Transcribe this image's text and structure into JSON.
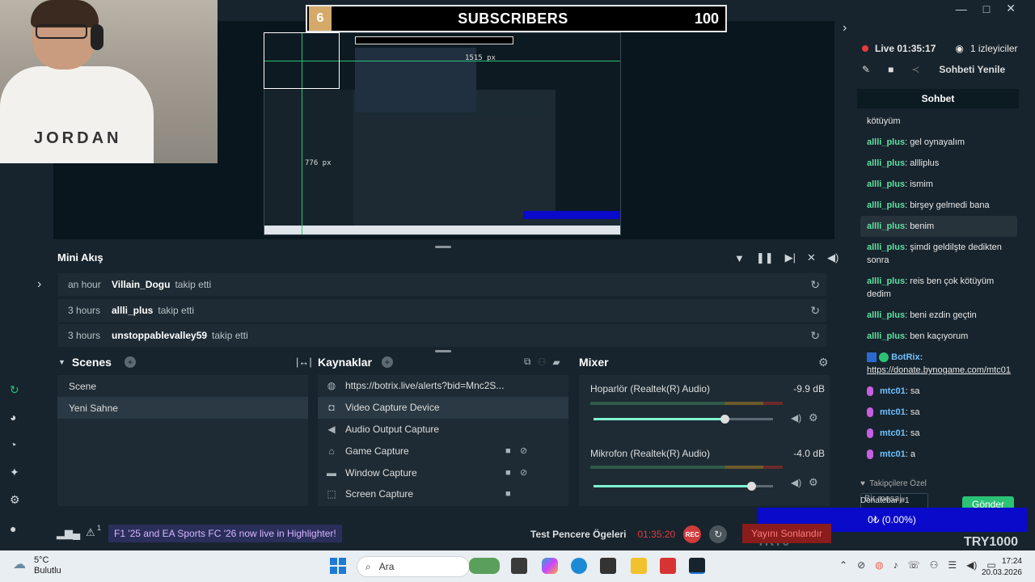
{
  "window": {
    "controls": [
      "—",
      "□",
      "✕"
    ]
  },
  "overlay": {
    "sub_count": "6",
    "sub_title": "SUBSCRIBERS",
    "sub_goal": "100",
    "webcam_text": "JORDAN"
  },
  "canvas_preview": {
    "guide_h": "1515 px",
    "guide_v": "776 px"
  },
  "stream": {
    "live_label": "Live 01:35:17",
    "viewers": "1 izleyiciler",
    "refresh_chat": "Sohbeti Yenile"
  },
  "chat": {
    "title": "Sohbet",
    "messages": [
      {
        "user": "",
        "text": "kötüyüm"
      },
      {
        "user": "allli_plus",
        "text": ": gel oynayalım"
      },
      {
        "user": "allli_plus",
        "text": ": allliplus"
      },
      {
        "user": "allli_plus",
        "text": ": ismim"
      },
      {
        "user": "allli_plus",
        "text": ": birşey gelmedi bana"
      },
      {
        "user": "allli_plus",
        "text": ": benim"
      },
      {
        "user": "allli_plus",
        "text": ": şimdi geldilşte dedikten sonra"
      },
      {
        "user": "allli_plus",
        "text": ": reis ben çok kötüyüm dedim"
      },
      {
        "user": "allli_plus",
        "text": ": beni ezdin geçtin"
      },
      {
        "user": "allli_plus",
        "text": ": ben kaçıyorum"
      }
    ],
    "bot": {
      "name": "BotRix:",
      "link": "https://donate.bynogame.com/mtc01"
    },
    "mic_messages": [
      {
        "user": "mtc01",
        "text": ": sa"
      },
      {
        "user": "mtc01",
        "text": ": sa"
      },
      {
        "user": "mtc01",
        "text": ": sa"
      },
      {
        "user": "mtc01",
        "text": ": a"
      }
    ],
    "followers_only": "Takipçilere Özel",
    "input_placeholder": "Bir mesaj",
    "send_label": "Gönder"
  },
  "donate": {
    "label": "Donatebar #1",
    "progress_text": "0₺ (0.00%)",
    "progress": 0,
    "brand": "TRY1000",
    "brand2": "TRY0"
  },
  "mini_feed": {
    "title": "Mini Akış",
    "rows": [
      {
        "time": "an hour",
        "name": "Villain_Dogu",
        "action": "takip etti"
      },
      {
        "time": "3 hours",
        "name": "allli_plus",
        "action": "takip etti"
      },
      {
        "time": "3 hours",
        "name": "unstoppablevalley59",
        "action": "takip etti"
      }
    ]
  },
  "scenes": {
    "title": "Scenes",
    "items": [
      "Scene",
      "Yeni Sahne"
    ],
    "selected": 1
  },
  "sources": {
    "title": "Kaynaklar",
    "items": [
      {
        "label": "https://botrix.live/alerts?bid=Mnc2S...",
        "icon": "globe-icon",
        "glyph": "◍",
        "lock": false,
        "eye": false
      },
      {
        "label": "Video Capture Device",
        "icon": "camera-icon",
        "glyph": "◘",
        "lock": false,
        "eye": false
      },
      {
        "label": "Audio Output Capture",
        "icon": "speaker-icon",
        "glyph": "◀",
        "lock": false,
        "eye": false
      },
      {
        "label": "Game Capture",
        "icon": "gamepad-icon",
        "glyph": "⌂",
        "lock": true,
        "eye": true
      },
      {
        "label": "Window Capture",
        "icon": "window-icon",
        "glyph": "▬",
        "lock": true,
        "eye": true
      },
      {
        "label": "Screen Capture",
        "icon": "screen-icon",
        "glyph": "⬚",
        "lock": true,
        "eye": false
      }
    ],
    "selected": 1
  },
  "mixer": {
    "title": "Mixer",
    "channels": [
      {
        "name": "Hoparlör (Realtek(R) Audio)",
        "db": "-9.9 dB",
        "level": 0.73
      },
      {
        "name": "Mikrofon (Realtek(R) Audio)",
        "db": "-4.0 dB",
        "level": 0.88
      }
    ]
  },
  "statusbar": {
    "notice": "F1 '25 and EA Sports FC '26 now live in Highlighter!",
    "alert_count": "1",
    "test_label": "Test Pencere Ögeleri",
    "rec_time": "01:35:20",
    "rec_label": "REC",
    "go_live": "Yayını Sonlandır"
  },
  "taskbar": {
    "temp": "5°C",
    "weather": "Bulutlu",
    "search": "Ara",
    "time": "17:24",
    "date": "20.03.2026"
  },
  "colors": {
    "accent": "#80f5d2",
    "chat_user": "#5fe0a0",
    "live": "#e53b3b",
    "donate": "#0a0acb"
  }
}
